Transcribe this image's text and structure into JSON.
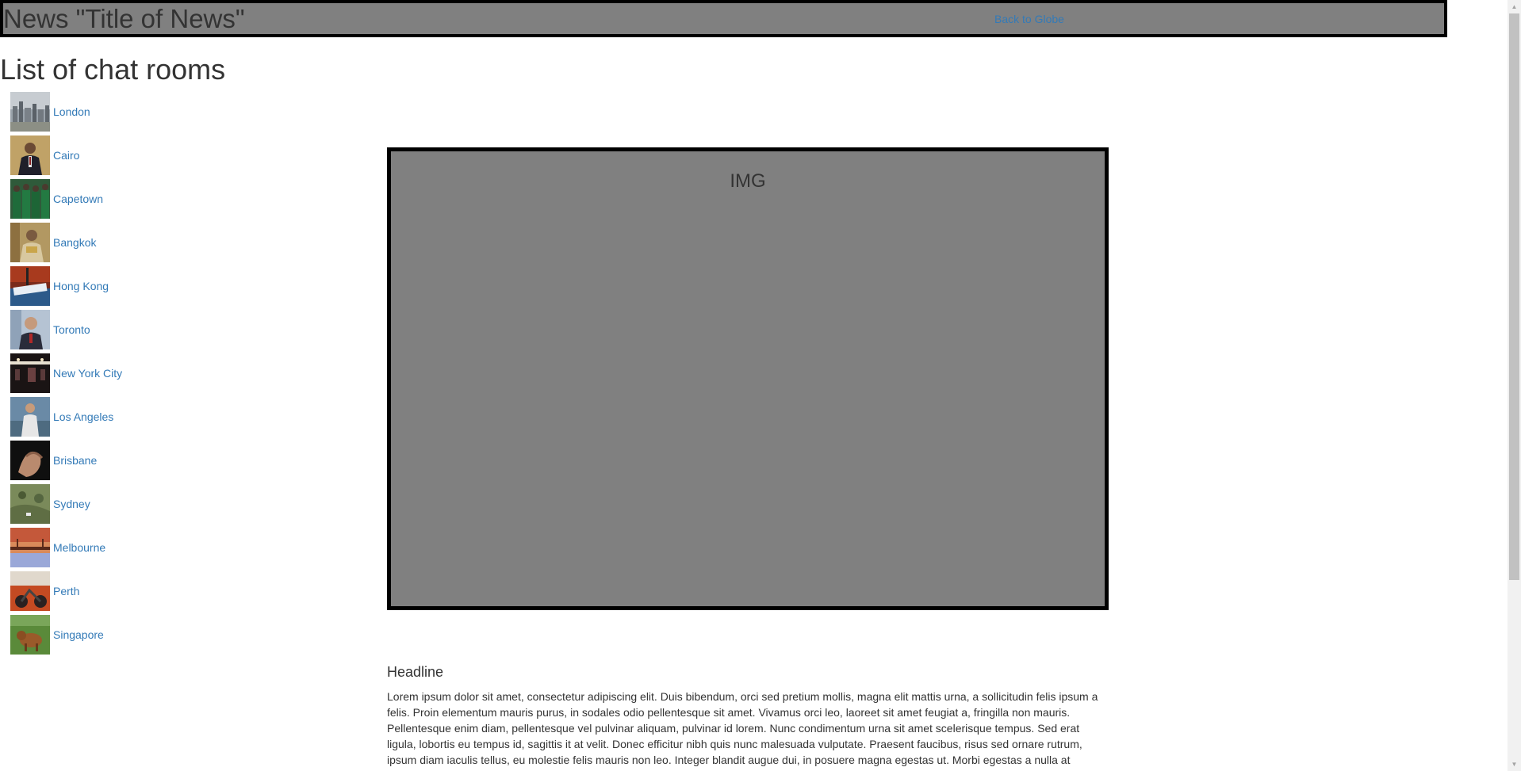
{
  "header": {
    "title": "News \"Title of News\"",
    "back_link": "Back to Globe"
  },
  "sidebar": {
    "title": "List of chat rooms",
    "rooms": [
      {
        "label": "London",
        "thumb": "city-skyline-thumbnail"
      },
      {
        "label": "Cairo",
        "thumb": "man-in-suit-thumbnail"
      },
      {
        "label": "Capetown",
        "thumb": "group-in-green-thumbnail"
      },
      {
        "label": "Bangkok",
        "thumb": "portrait-thumbnail"
      },
      {
        "label": "Hong Kong",
        "thumb": "protest-sign-thumbnail"
      },
      {
        "label": "Toronto",
        "thumb": "man-portrait-thumbnail"
      },
      {
        "label": "New York City",
        "thumb": "night-street-thumbnail"
      },
      {
        "label": "Los Angeles",
        "thumb": "person-outdoors-thumbnail"
      },
      {
        "label": "Brisbane",
        "thumb": "hands-thumbnail"
      },
      {
        "label": "Sydney",
        "thumb": "aerial-view-thumbnail"
      },
      {
        "label": "Melbourne",
        "thumb": "sunset-bridge-thumbnail"
      },
      {
        "label": "Perth",
        "thumb": "motorbike-thumbnail"
      },
      {
        "label": "Singapore",
        "thumb": "animal-in-grass-thumbnail"
      }
    ]
  },
  "article": {
    "image_placeholder": "IMG",
    "headline": "Headline",
    "body": "Lorem ipsum dolor sit amet, consectetur adipiscing elit. Duis bibendum, orci sed pretium mollis, magna elit mattis urna, a sollicitudin felis ipsum a felis. Proin elementum mauris purus, in sodales odio pellentesque sit amet. Vivamus orci leo, laoreet sit amet feugiat a, fringilla non mauris. Pellentesque enim diam, pellentesque vel pulvinar aliquam, pulvinar id lorem. Nunc condimentum urna sit amet scelerisque tempus. Sed erat ligula, lobortis eu tempus id, sagittis it at velit. Donec efficitur nibh quis nunc malesuada vulputate. Praesent faucibus, risus sed ornare rutrum, ipsum diam iaculis tellus, eu molestie felis mauris non leo. Integer blandit augue dui, in posuere magna egestas ut. Morbi egestas a nulla at"
  },
  "colors": {
    "header_bg": "#808080",
    "border": "#000000",
    "link": "#337ab7",
    "text": "#333333"
  }
}
